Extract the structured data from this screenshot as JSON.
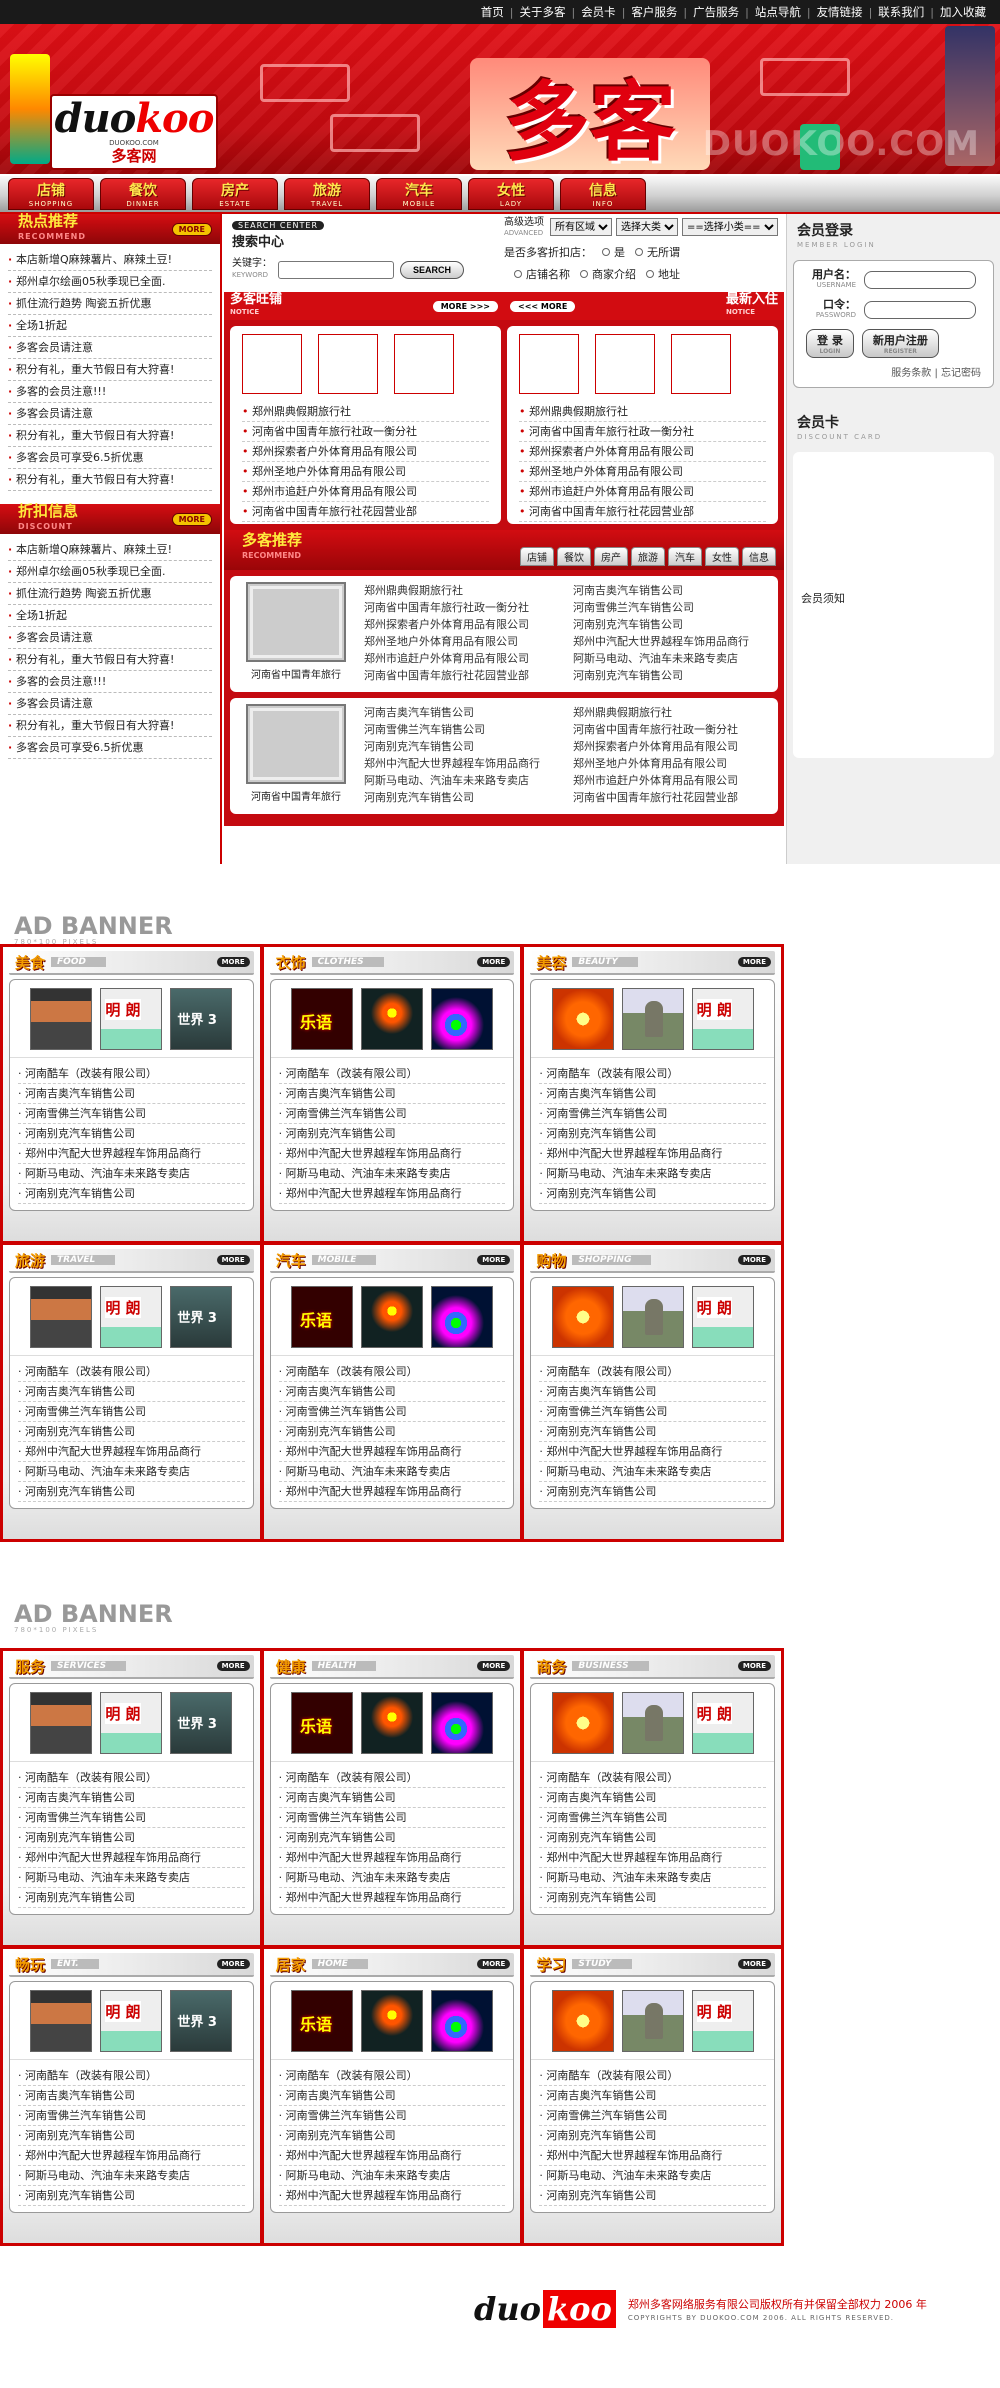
{
  "topnav": [
    "首页",
    "关于多客",
    "会员卡",
    "客户服务",
    "广告服务",
    "站点导航",
    "友情链接",
    "联系我们",
    "加入收藏"
  ],
  "logo": {
    "main_a": "duo",
    "main_b": "koo",
    "sub": "多客网",
    "url": "DUOKOO.COM"
  },
  "banner": {
    "title": "多客",
    "watermark": "DUOKOO.COM"
  },
  "nav": [
    {
      "cn": "店铺",
      "en": "SHOPPING"
    },
    {
      "cn": "餐饮",
      "en": "DINNER"
    },
    {
      "cn": "房产",
      "en": "ESTATE"
    },
    {
      "cn": "旅游",
      "en": "TRAVEL"
    },
    {
      "cn": "汽车",
      "en": "MOBILE"
    },
    {
      "cn": "女性",
      "en": "LADY"
    },
    {
      "cn": "信息",
      "en": "INFO"
    }
  ],
  "hot": {
    "title": "热点推荐",
    "en": "RECOMMEND",
    "more": "MORE",
    "items": [
      "本店新增Q麻辣薯片、麻辣土豆!",
      "郑州卓尔绘画05秋季现已全面.",
      "抓住流行趋势 陶瓷五折优惠",
      "全场1折起",
      "多客会员请注意",
      "积分有礼，重大节假日有大狩喜!",
      "多客的会员注意!!!",
      "多客会员请注意",
      "积分有礼，重大节假日有大狩喜!",
      "多客会员可享受6.5折优惠",
      "积分有礼，重大节假日有大狩喜!"
    ]
  },
  "discount": {
    "title": "折扣信息",
    "en": "DISCOUNT",
    "more": "MORE",
    "items": [
      "本店新增Q麻辣薯片、麻辣土豆!",
      "郑州卓尔绘画05秋季现已全面.",
      "抓住流行趋势 陶瓷五折优惠",
      "全场1折起",
      "多客会员请注意",
      "积分有礼，重大节假日有大狩喜!",
      "多客的会员注意!!!",
      "多客会员请注意",
      "积分有礼，重大节假日有大狩喜!",
      "多客会员可享受6.5折优惠"
    ]
  },
  "search": {
    "tag": "SEARCH CENTER",
    "title": "搜索中心",
    "kw_label": "关键字：",
    "kw_en": "KEYWORD",
    "btn": "SEARCH",
    "adv_label": "高级选项",
    "adv_en": "ADVANCED",
    "sel_area": "所有区域",
    "sel_big": "选择大类",
    "sel_small": "==选择小类==",
    "discount_q": "是否多客折扣店：",
    "opt_yes": "是",
    "opt_none": "无所谓",
    "opt_shop": "店铺名称",
    "opt_intro": "商家介绍",
    "opt_addr": "地址"
  },
  "shops": {
    "left_title": "多客旺铺",
    "left_en": "NOTICE",
    "left_more": "MORE >>>",
    "right_more": "<<< MORE",
    "right_title": "最新入住",
    "right_en": "NOTICE",
    "left_items": [
      "郑州鼎典假期旅行社",
      "河南省中国青年旅行社政一衡分社",
      "郑州探索者户外体育用品有限公司",
      "郑州圣地户外体育用品有限公司",
      "郑州市追赶户外体育用品有限公司",
      "河南省中国青年旅行社花园营业部"
    ],
    "right_items": [
      "郑州鼎典假期旅行社",
      "河南省中国青年旅行社政一衡分社",
      "郑州探索者户外体育用品有限公司",
      "郑州圣地户外体育用品有限公司",
      "郑州市追赶户外体育用品有限公司",
      "河南省中国青年旅行社花园营业部"
    ]
  },
  "recommend": {
    "title": "多客推荐",
    "en": "RECOMMEND",
    "tabs": [
      "店铺",
      "餐饮",
      "房产",
      "旅游",
      "汽车",
      "女性",
      "信息"
    ],
    "boxes": [
      {
        "caption": "河南省中国青年旅行",
        "col1": [
          "郑州鼎典假期旅行社",
          "河南省中国青年旅行社政一衡分社",
          "郑州探索者户外体育用品有限公司",
          "郑州圣地户外体育用品有限公司",
          "郑州市追赶户外体育用品有限公司",
          "河南省中国青年旅行社花园营业部"
        ],
        "col2": [
          "河南吉奥汽车销售公司",
          "河南雪佛兰汽车销售公司",
          "河南别克汽车销售公司",
          "郑州中汽配大世界越程车饰用品商行",
          "阿斯马电动、汽油车未来路专卖店",
          "河南别克汽车销售公司"
        ]
      },
      {
        "caption": "河南省中国青年旅行",
        "col1": [
          "河南吉奥汽车销售公司",
          "河南雪佛兰汽车销售公司",
          "河南别克汽车销售公司",
          "郑州中汽配大世界越程车饰用品商行",
          "阿斯马电动、汽油车未来路专卖店",
          "河南别克汽车销售公司"
        ],
        "col2": [
          "郑州鼎典假期旅行社",
          "河南省中国青年旅行社政一衡分社",
          "郑州探索者户外体育用品有限公司",
          "郑州圣地户外体育用品有限公司",
          "郑州市追赶户外体育用品有限公司",
          "河南省中国青年旅行社花园营业部"
        ]
      }
    ]
  },
  "member": {
    "title": "会员登录",
    "en": "MEMBER LOGIN",
    "user_label": "用户名：",
    "user_en": "USERNAME",
    "pass_label": "口令：",
    "pass_en": "PASSWORD",
    "login_btn": "登 录",
    "login_en": "LOGIN",
    "reg_btn": "新用户注册",
    "reg_en": "REGISTER",
    "terms": "服务条款",
    "forgot": "忘记密码",
    "card_title": "会员卡",
    "card_en": "DISCOUNT CARD",
    "notice": "会员须知"
  },
  "ad_banner": {
    "title": "AD BANNER",
    "sub": "780*100 PIXELS"
  },
  "cat_items": [
    "河南酷车（改装有限公司）",
    "河南吉奥汽车销售公司",
    "河南雪佛兰汽车销售公司",
    "河南别克汽车销售公司",
    "郑州中汽配大世界越程车饰用品商行",
    "阿斯马电动、汽油车未来路专卖店",
    "河南别克汽车销售公司"
  ],
  "cat_items_alt": [
    "河南酷车（改装有限公司）",
    "河南吉奥汽车销售公司",
    "河南雪佛兰汽车销售公司",
    "河南别克汽车销售公司",
    "郑州中汽配大世界越程车饰用品商行",
    "阿斯马电动、汽油车未来路专卖店",
    "郑州中汽配大世界越程车饰用品商行"
  ],
  "grid1": [
    {
      "cn": "美食",
      "en": "FOOD",
      "thumbs": [
        "t-store",
        "t-sign",
        "t-world"
      ],
      "alt": false
    },
    {
      "cn": "衣饰",
      "en": "CLOTHES",
      "thumbs": [
        "t-neon",
        "t-night",
        "t-party"
      ],
      "alt": true
    },
    {
      "cn": "美容",
      "en": "BEAUTY",
      "thumbs": [
        "t-orange",
        "t-statue",
        "t-sign"
      ],
      "alt": false
    },
    {
      "cn": "旅游",
      "en": "TRAVEL",
      "thumbs": [
        "t-store",
        "t-sign",
        "t-world"
      ],
      "alt": false
    },
    {
      "cn": "汽车",
      "en": "MOBILE",
      "thumbs": [
        "t-neon",
        "t-night",
        "t-party"
      ],
      "alt": true
    },
    {
      "cn": "购物",
      "en": "SHOPPING",
      "thumbs": [
        "t-orange",
        "t-statue",
        "t-sign"
      ],
      "alt": false
    }
  ],
  "grid2": [
    {
      "cn": "服务",
      "en": "SERVICES",
      "thumbs": [
        "t-store",
        "t-sign",
        "t-world"
      ],
      "alt": false
    },
    {
      "cn": "健康",
      "en": "HEALTH",
      "thumbs": [
        "t-neon",
        "t-night",
        "t-party"
      ],
      "alt": true
    },
    {
      "cn": "商务",
      "en": "BUSINESS",
      "thumbs": [
        "t-orange",
        "t-statue",
        "t-sign"
      ],
      "alt": false
    },
    {
      "cn": "畅玩",
      "en": "ENT.",
      "thumbs": [
        "t-store",
        "t-sign",
        "t-world"
      ],
      "alt": false
    },
    {
      "cn": "居家",
      "en": "HOME",
      "thumbs": [
        "t-neon",
        "t-night",
        "t-party"
      ],
      "alt": true
    },
    {
      "cn": "学习",
      "en": "STUDY",
      "thumbs": [
        "t-orange",
        "t-statue",
        "t-sign"
      ],
      "alt": false
    }
  ],
  "more_label": "MORE",
  "footer": {
    "logo_a": "duo",
    "logo_b": "koo",
    "text": "郑州多客网络服务有限公司版权所有并保留全部权力 2006 年",
    "copy": "COPYRIGHTS BY DUOKOO.COM 2006. ALL RIGHTS RESERVED."
  }
}
